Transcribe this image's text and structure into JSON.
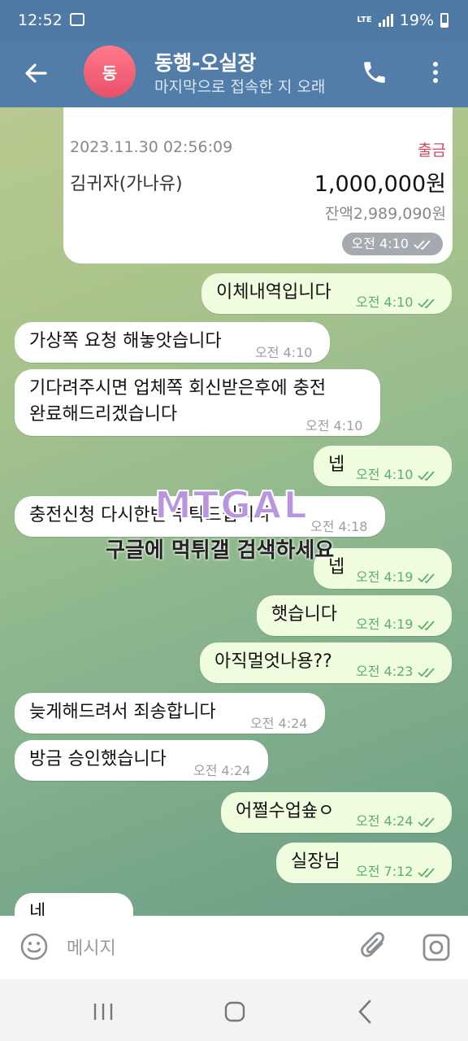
{
  "status": {
    "time": "12:52",
    "network": "LTE",
    "battery": "19%"
  },
  "header": {
    "avatar_initial": "동",
    "title": "동행-오실장",
    "subtitle": "마지막으로 접속한 지 오래"
  },
  "receipt": {
    "date": "2023.11.30 02:56:09",
    "kind": "출금",
    "name": "김귀자(가나유)",
    "amount": "1,000,000원",
    "balance": "잔액2,989,090원",
    "time": "오전 4:10"
  },
  "messages": [
    {
      "dir": "out",
      "text": "이체내역입니다",
      "time": "오전 4:10"
    },
    {
      "dir": "in",
      "text": "가상쪽 요청 해놓앗습니다",
      "time": "오전 4:10"
    },
    {
      "dir": "in",
      "text": "기다려주시면 업체쪽 회신받은후에 충전\n완료해드리겠습니다",
      "time": "오전 4:10"
    },
    {
      "dir": "out",
      "text": "넵",
      "time": "오전 4:10"
    },
    {
      "dir": "in",
      "text": "충전신청 다시한번 부탁드립니다",
      "time": "오전 4:18"
    },
    {
      "dir": "out",
      "text": "넵",
      "time": "오전 4:19"
    },
    {
      "dir": "out",
      "text": "햇습니다",
      "time": "오전 4:19"
    },
    {
      "dir": "out",
      "text": "아직멀엇나용??",
      "time": "오전 4:23"
    },
    {
      "dir": "in",
      "text": "늦게해드려서 죄송합니다",
      "time": "오전 4:24"
    },
    {
      "dir": "in",
      "text": "방금 승인했습니다",
      "time": "오전 4:24"
    },
    {
      "dir": "out",
      "text": "어쩔수업숖ㅇ",
      "time": "오전 4:24"
    },
    {
      "dir": "out",
      "text": "실장님",
      "time": "오전 7:12"
    },
    {
      "dir": "in",
      "text": "네",
      "time": ""
    }
  ],
  "watermark": {
    "logo": "MTGAL",
    "text": "구글에 먹튀갤 검색하세요"
  },
  "input": {
    "placeholder": "메시지"
  },
  "colors": {
    "header": "#517da8",
    "out_bubble": "#effdde",
    "in_bubble": "#ffffff",
    "time_out": "#5fae6a"
  }
}
